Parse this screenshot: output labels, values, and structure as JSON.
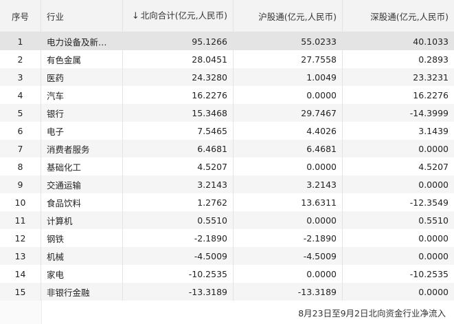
{
  "headers": {
    "index": "序号",
    "industry": "行业",
    "north_arrow": "↓",
    "north": "北向合计(亿元,人民币)",
    "sh": "沪股通(亿元,人民币)",
    "sz": "深股通(亿元,人民币)"
  },
  "rows": [
    {
      "index": "1",
      "industry": "电力设备及新…",
      "north": "95.1266",
      "sh": "55.0233",
      "sz": "40.1033"
    },
    {
      "index": "2",
      "industry": "有色金属",
      "north": "28.0451",
      "sh": "27.7558",
      "sz": "0.2893"
    },
    {
      "index": "3",
      "industry": "医药",
      "north": "24.3280",
      "sh": "1.0049",
      "sz": "23.3231"
    },
    {
      "index": "4",
      "industry": "汽车",
      "north": "16.2276",
      "sh": "0.0000",
      "sz": "16.2276"
    },
    {
      "index": "5",
      "industry": "银行",
      "north": "15.3468",
      "sh": "29.7467",
      "sz": "-14.3999"
    },
    {
      "index": "6",
      "industry": "电子",
      "north": "7.5465",
      "sh": "4.4026",
      "sz": "3.1439"
    },
    {
      "index": "7",
      "industry": "消费者服务",
      "north": "6.4681",
      "sh": "6.4681",
      "sz": "0.0000"
    },
    {
      "index": "8",
      "industry": "基础化工",
      "north": "4.5207",
      "sh": "0.0000",
      "sz": "4.5207"
    },
    {
      "index": "9",
      "industry": "交通运输",
      "north": "3.2143",
      "sh": "3.2143",
      "sz": "0.0000"
    },
    {
      "index": "10",
      "industry": "食品饮料",
      "north": "1.2762",
      "sh": "13.6311",
      "sz": "-12.3549"
    },
    {
      "index": "11",
      "industry": "计算机",
      "north": "0.5510",
      "sh": "0.0000",
      "sz": "0.5510"
    },
    {
      "index": "12",
      "industry": "钢铁",
      "north": "-2.1890",
      "sh": "-2.1890",
      "sz": "0.0000"
    },
    {
      "index": "13",
      "industry": "机械",
      "north": "-4.5009",
      "sh": "-4.5009",
      "sz": "0.0000"
    },
    {
      "index": "14",
      "industry": "家电",
      "north": "-10.2535",
      "sh": "0.0000",
      "sz": "-10.2535"
    },
    {
      "index": "15",
      "industry": "非银行金融",
      "north": "-13.3189",
      "sh": "-13.3189",
      "sz": "0.0000"
    }
  ],
  "footer_note": "8月23日至9月2日北向资金行业净流入"
}
